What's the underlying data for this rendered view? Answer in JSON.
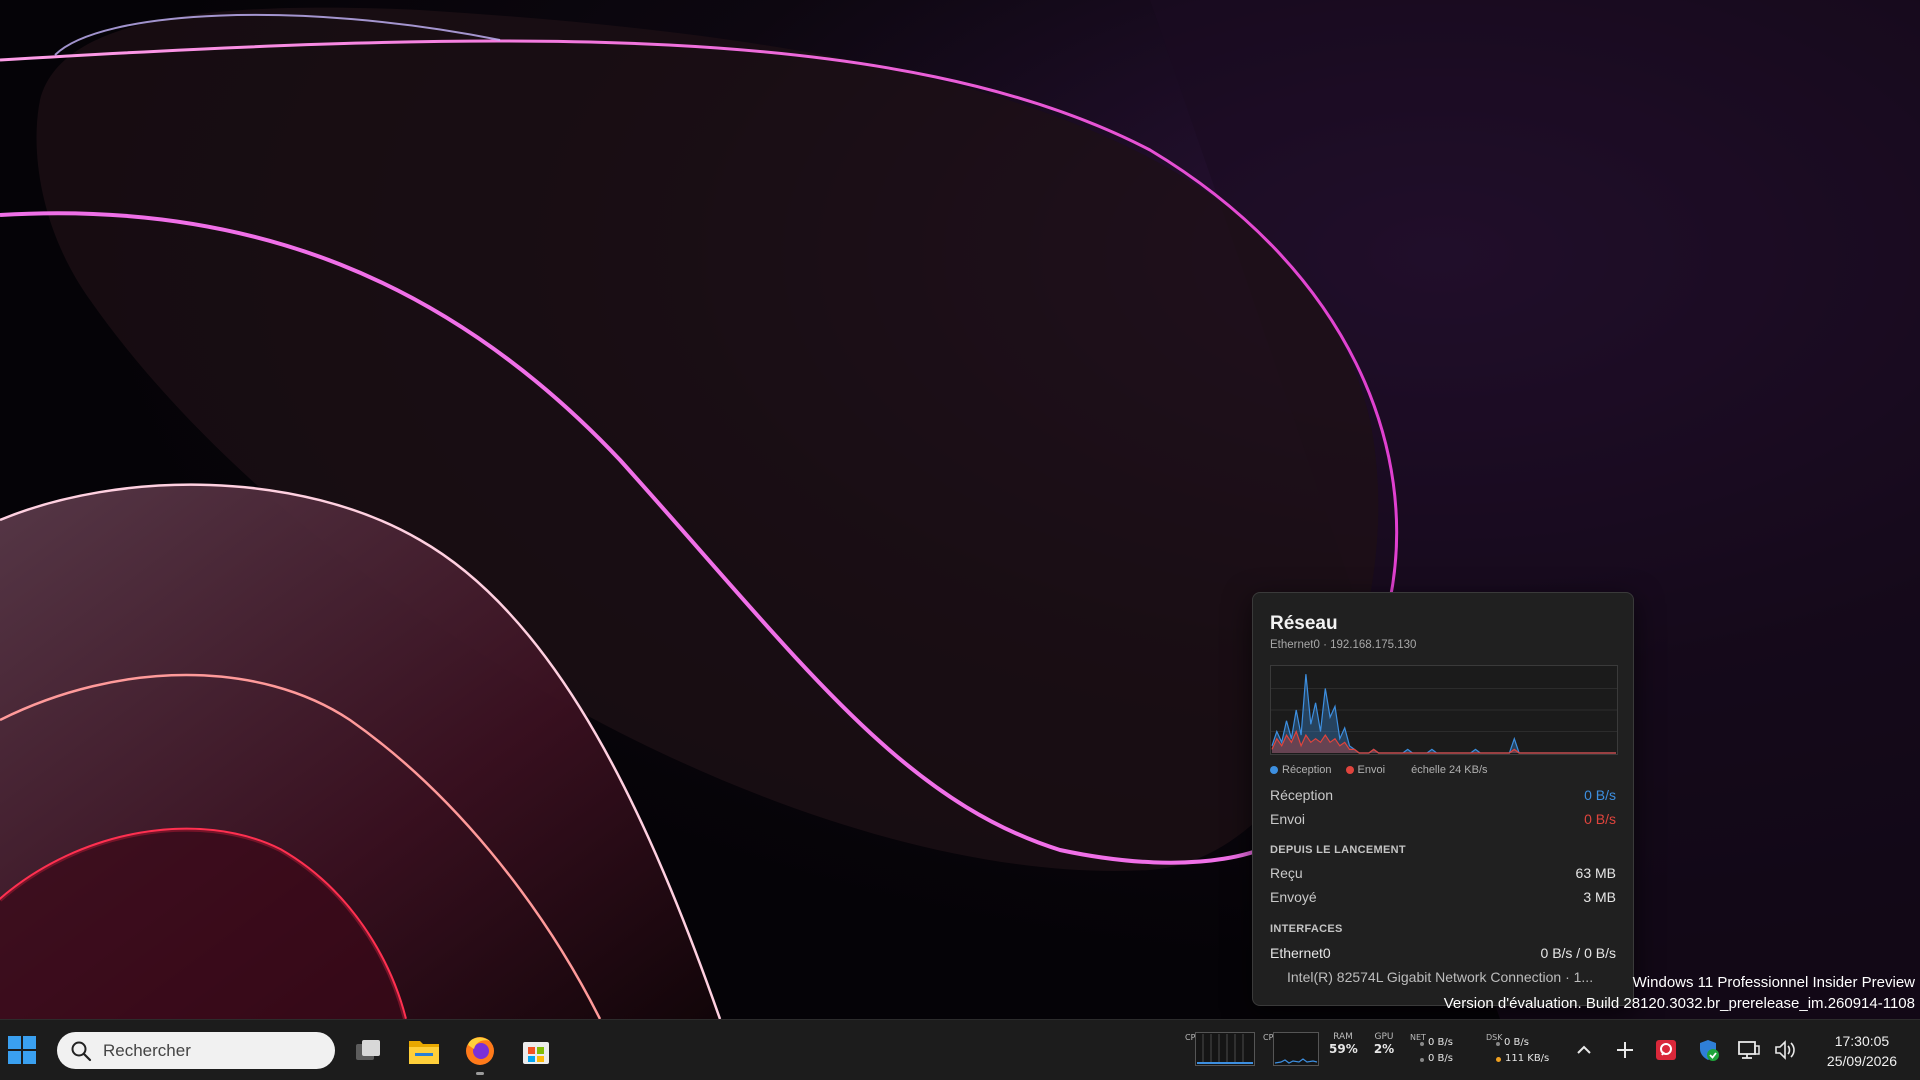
{
  "network_panel": {
    "title": "Réseau",
    "subtitle": "Ethernet0 · 192.168.175.130",
    "legend": {
      "receive": "Réception",
      "send": "Envoi",
      "scale": "échelle 24 KB/s"
    },
    "current": {
      "receive_label": "Réception",
      "receive_value": "0 B/s",
      "send_label": "Envoi",
      "send_value": "0 B/s"
    },
    "since_launch": {
      "heading": "DEPUIS LE LANCEMENT",
      "received_label": "Reçu",
      "received_value": "63 MB",
      "sent_label": "Envoyé",
      "sent_value": "3 MB"
    },
    "interfaces": {
      "heading": "INTERFACES",
      "name": "Ethernet0",
      "rate": "0 B/s / 0 B/s",
      "description": "Intel(R) 82574L Gigabit Network Connection · 1..."
    },
    "colors": {
      "receive": "#3d8fe0",
      "send": "#e0443d"
    }
  },
  "chart_data": {
    "type": "area",
    "unit": "KB/s",
    "ylim": [
      0,
      24
    ],
    "series": [
      {
        "name": "Réception",
        "values": [
          2,
          6,
          3,
          9,
          4,
          12,
          5,
          22,
          8,
          14,
          6,
          18,
          10,
          13,
          4,
          7,
          2,
          1,
          0,
          0,
          0,
          1,
          0,
          0,
          0,
          0,
          0,
          0,
          1,
          0,
          0,
          0,
          0,
          1,
          0,
          0,
          0,
          0,
          0,
          0,
          0,
          0,
          1,
          0,
          0,
          0,
          0,
          0,
          0,
          0,
          4,
          0,
          0,
          0,
          0,
          0,
          0,
          0,
          0,
          0,
          0,
          0,
          0,
          0,
          0,
          0,
          0,
          0,
          0,
          0,
          0,
          0
        ]
      },
      {
        "name": "Envoi",
        "values": [
          1,
          4,
          2,
          5,
          3,
          6,
          2,
          5,
          3,
          4,
          3,
          5,
          3,
          4,
          2,
          3,
          1,
          1,
          0,
          0,
          0,
          1,
          0,
          0,
          0,
          0,
          0,
          0,
          0,
          0,
          0,
          0,
          0,
          0,
          0,
          0,
          0,
          0,
          0,
          0,
          0,
          0,
          0,
          0,
          0,
          0,
          0,
          0,
          0,
          0,
          1,
          0,
          0,
          0,
          0,
          0,
          0,
          0,
          0,
          0,
          0,
          0,
          0,
          0,
          0,
          0,
          0,
          0,
          0,
          0,
          0,
          0
        ]
      }
    ]
  },
  "watermark": {
    "line1": "Windows 11 Professionnel Insider Preview",
    "line2": "Version d'évaluation. Build 28120.3032.br_prerelease_im.260914-1108"
  },
  "taskbar": {
    "search_placeholder": "Rechercher",
    "apps": [
      "task-view",
      "file-explorer",
      "firefox",
      "microsoft-store"
    ],
    "monitors": {
      "cpu_label": "CPU",
      "cpu2_label": "CPU",
      "ram_label": "RAM",
      "ram_value": "59%",
      "gpu_label": "GPU",
      "gpu_value": "2%",
      "net_label": "NET",
      "net_down": "0 B/s",
      "net_up": "0 B/s",
      "disk_label": "DSK",
      "disk_read": "0 B/s",
      "disk_write": "111 KB/s"
    },
    "clock": {
      "time": "17:30:05",
      "date": "25/09/2026"
    }
  }
}
